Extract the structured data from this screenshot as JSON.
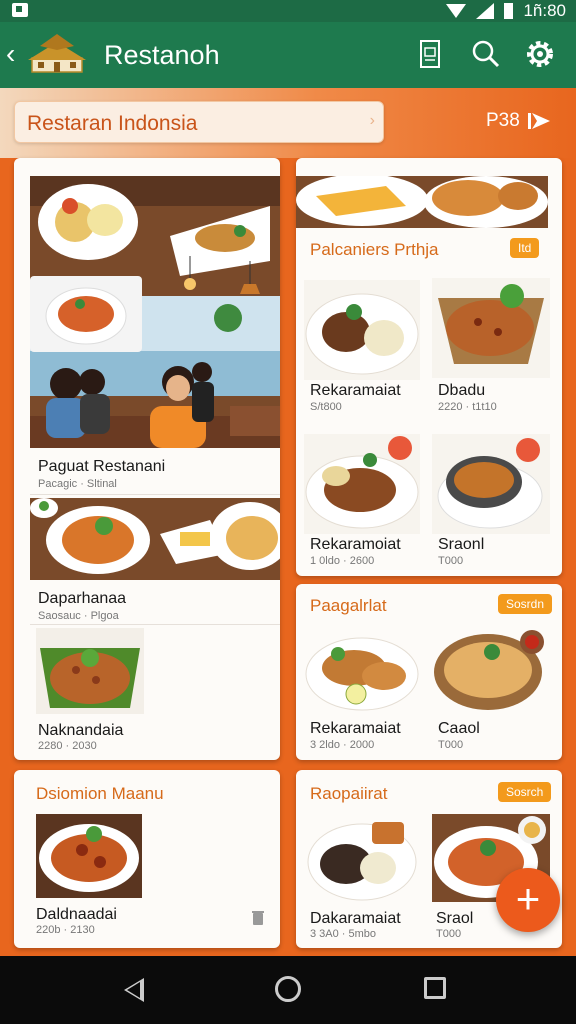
{
  "status_bar": {
    "time": "1ñ:80"
  },
  "app_bar": {
    "title": "Restanoh"
  },
  "search": {
    "value": "Restaran Indonsia"
  },
  "page_indicator": {
    "label": "P38"
  },
  "left_column": {
    "hero": {
      "title": "Paguat Restanani",
      "subtitle": "Pacagic · Sltinal"
    },
    "item_a": {
      "title": "Daparhanaa",
      "subtitle": "Saosauc · Plgoa"
    },
    "item_b": {
      "title": "Naknandaia",
      "subtitle": "2280 · 2030"
    },
    "section2": {
      "title": "Dsiomion Maanu",
      "item": {
        "title": "Daldnaadai",
        "subtitle": "220b · 2130"
      }
    }
  },
  "right_column": {
    "section1": {
      "title": "Palcaniers Prthja",
      "badge": "Itd",
      "items": [
        {
          "title": "Rekaramaiat",
          "subtitle": "S/t800"
        },
        {
          "title": "Dbadu",
          "subtitle": "2220 · t1t10"
        },
        {
          "title": "Rekaramoiat",
          "subtitle": "1 0ldo · 2600"
        },
        {
          "title": "Sraonl",
          "subtitle": "T000"
        }
      ]
    },
    "section2": {
      "title": "Paagalrlat",
      "badge": "Sosrdn",
      "items": [
        {
          "title": "Rekaramaiat",
          "subtitle": "3 2ldo · 2000"
        },
        {
          "title": "Caaol",
          "subtitle": "T000"
        }
      ]
    },
    "section3": {
      "title": "Raopaiirat",
      "badge": "Sosrch",
      "items": [
        {
          "title": "Dakaramaiat",
          "subtitle": "3 3A0 · 5mbo"
        },
        {
          "title": "Sraol",
          "subtitle": "T000"
        }
      ]
    }
  },
  "fab": {
    "label": "+"
  },
  "colors": {
    "primary": "#1e7a4e",
    "accent": "#ec5a1c",
    "badge": "#f39a1c",
    "section_title": "#d66a1a"
  }
}
